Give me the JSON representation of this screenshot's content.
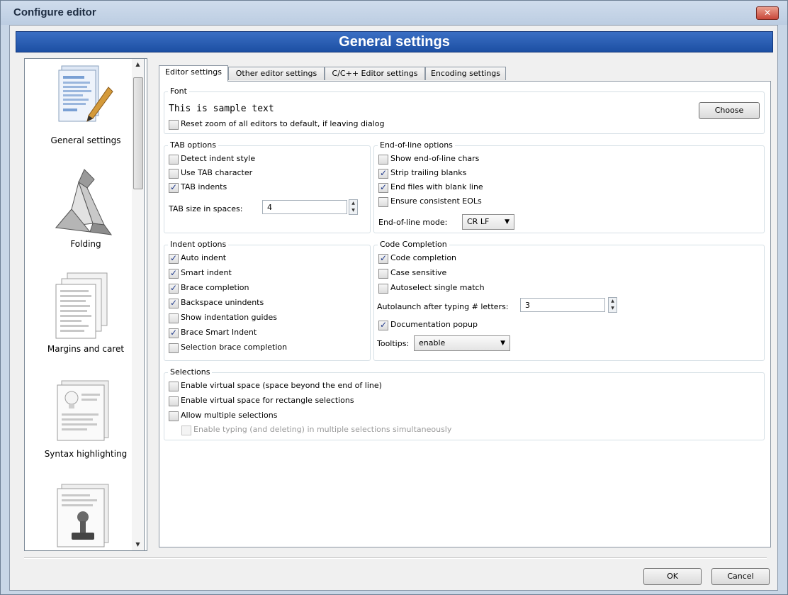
{
  "window": {
    "title": "Configure editor",
    "close_label": "✕"
  },
  "header": {
    "title": "General settings"
  },
  "sidebar": {
    "items": [
      {
        "label": "General settings",
        "icon": "document-pencil-icon"
      },
      {
        "label": "Folding",
        "icon": "origami-icon"
      },
      {
        "label": "Margins and caret",
        "icon": "document-stack-icon"
      },
      {
        "label": "Syntax highlighting",
        "icon": "lightbulb-document-icon"
      },
      {
        "label": "",
        "icon": "stamp-document-icon"
      }
    ],
    "scroll_up": "▲",
    "scroll_down": "▼"
  },
  "tabs": [
    {
      "label": "Editor settings",
      "active": true
    },
    {
      "label": "Other editor settings",
      "active": false
    },
    {
      "label": "C/C++ Editor settings",
      "active": false
    },
    {
      "label": "Encoding settings",
      "active": false
    }
  ],
  "font": {
    "title": "Font",
    "sample": "This is sample text",
    "choose_label": "Choose",
    "reset_zoom": {
      "label": "Reset zoom of all editors to default, if leaving dialog",
      "checked": false
    }
  },
  "tab_options": {
    "title": "TAB options",
    "checkboxes": [
      {
        "label": "Detect indent style",
        "checked": false
      },
      {
        "label": "Use TAB character",
        "checked": false
      },
      {
        "label": "TAB indents",
        "checked": true
      }
    ],
    "size_label": "TAB size in spaces:",
    "size_value": "4"
  },
  "eol_options": {
    "title": "End-of-line options",
    "checkboxes": [
      {
        "label": "Show end-of-line chars",
        "checked": false
      },
      {
        "label": "Strip trailing blanks",
        "checked": true
      },
      {
        "label": "End files with blank line",
        "checked": true
      },
      {
        "label": "Ensure consistent EOLs",
        "checked": false
      }
    ],
    "mode_label": "End-of-line mode:",
    "mode_value": "CR LF"
  },
  "indent_options": {
    "title": "Indent options",
    "checkboxes": [
      {
        "label": "Auto indent",
        "checked": true
      },
      {
        "label": "Smart indent",
        "checked": true
      },
      {
        "label": "Brace completion",
        "checked": true
      },
      {
        "label": "Backspace unindents",
        "checked": true
      },
      {
        "label": "Show indentation guides",
        "checked": false
      },
      {
        "label": "Brace Smart Indent",
        "checked": true
      },
      {
        "label": "Selection brace completion",
        "checked": false
      }
    ]
  },
  "code_completion": {
    "title": "Code Completion",
    "checkboxes": [
      {
        "label": "Code completion",
        "checked": true
      },
      {
        "label": "Case sensitive",
        "checked": false
      },
      {
        "label": "Autoselect single match",
        "checked": false
      }
    ],
    "autolaunch_label": "Autolaunch after typing # letters:",
    "autolaunch_value": "3",
    "doc_popup": {
      "label": "Documentation popup",
      "checked": true
    },
    "tooltips_label": "Tooltips:",
    "tooltips_value": "enable"
  },
  "selections": {
    "title": "Selections",
    "checkboxes": [
      {
        "label": "Enable virtual space (space beyond the end of line)",
        "checked": false
      },
      {
        "label": "Enable virtual space for rectangle selections",
        "checked": false
      },
      {
        "label": "Allow multiple selections",
        "checked": false
      }
    ],
    "sub": {
      "label": "Enable typing (and deleting) in multiple selections simultaneously",
      "checked": false,
      "disabled": true
    }
  },
  "footer": {
    "ok_label": "OK",
    "cancel_label": "Cancel"
  },
  "glyphs": {
    "check": "✓",
    "spin_up": "▲",
    "spin_down": "▼",
    "dropdown": "▼"
  }
}
